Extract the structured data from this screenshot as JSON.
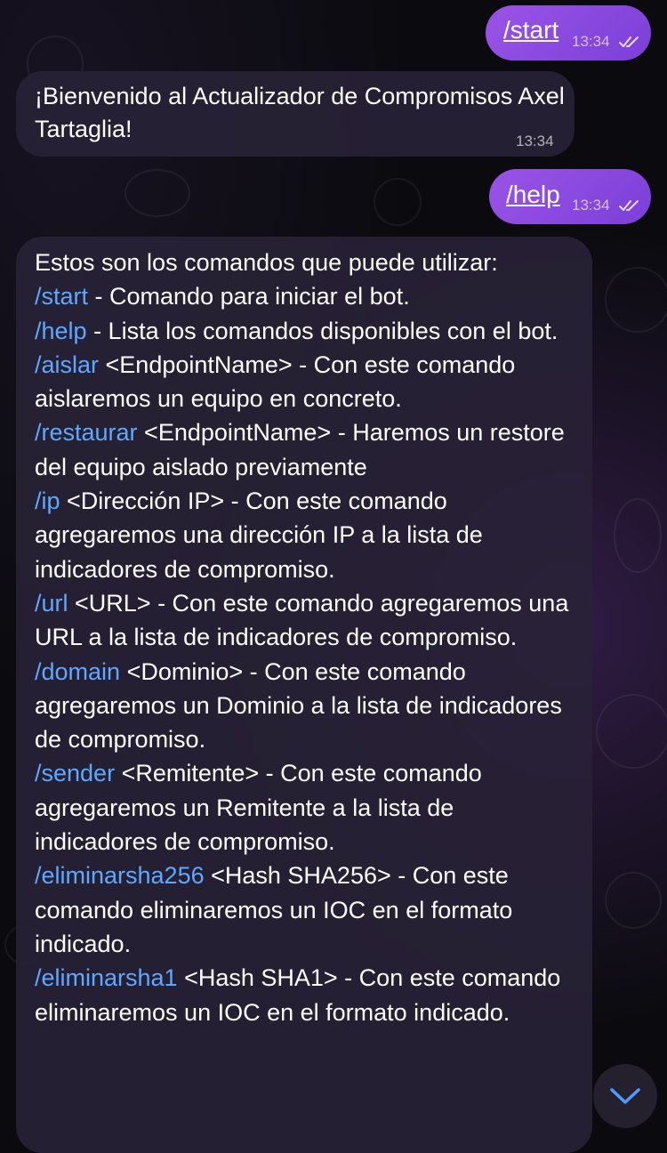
{
  "messages": {
    "start": {
      "text": "/start",
      "time": "13:34"
    },
    "welcome": {
      "text": "¡Bienvenido al Actualizador de Compromisos Axel Tartaglia!",
      "time": "13:34"
    },
    "help": {
      "text": "/help",
      "time": "13:34"
    },
    "help_reply": {
      "intro": "Estos son los comandos que puede utilizar:",
      "commands": [
        {
          "cmd": "/start",
          "desc": " - Comando para iniciar el bot."
        },
        {
          "cmd": "/help",
          "desc": " - Lista los comandos disponibles con el bot."
        },
        {
          "cmd": "/aislar",
          "desc": " <EndpointName> - Con este comando aislaremos un equipo en concreto."
        },
        {
          "cmd": "/restaurar",
          "desc": " <EndpointName> - Haremos un restore del equipo aislado previamente"
        },
        {
          "cmd": "/ip",
          "desc": " <Dirección IP> - Con este comando agregaremos una dirección IP a la lista de indicadores de compromiso."
        },
        {
          "cmd": "/url",
          "desc": " <URL> - Con este comando agregaremos una URL a la lista de indicadores de compromiso."
        },
        {
          "cmd": "/domain",
          "desc": " <Dominio> - Con este comando agregaremos un Dominio a la lista de indicadores de compromiso."
        },
        {
          "cmd": "/sender",
          "desc": " <Remitente> - Con este comando agregaremos un Remitente a la lista de indicadores de compromiso."
        },
        {
          "cmd": "/eliminarsha256",
          "desc": " <Hash SHA256> - Con este comando eliminaremos un IOC en el formato indicado."
        },
        {
          "cmd": "/eliminarsha1",
          "desc": " <Hash SHA1> - Con este comando eliminaremos un IOC en el formato indicado."
        }
      ]
    }
  },
  "icons": {
    "read_receipt": "double-check-icon",
    "scroll_down": "chevron-down-icon"
  },
  "colors": {
    "outgoing_bubble": "#8a49e0",
    "incoming_bubble": "#282236",
    "command_link": "#5ea8ff"
  }
}
